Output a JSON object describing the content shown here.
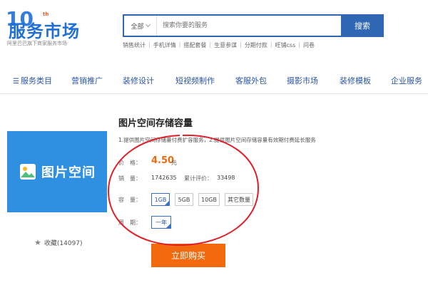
{
  "header": {
    "logo_text": "服务市场",
    "logo_number": "10",
    "logo_suffix": "th",
    "logo_subtitle": "阿里巴巴旗下商家服务市场",
    "search": {
      "category": "全部",
      "placeholder": "搜索你要的服务",
      "button_label": "搜索"
    },
    "hot_links": [
      "销售统计",
      "手机详情",
      "搭配套餐",
      "生意参谋",
      "分期付款",
      "旺铺css",
      "问卷"
    ]
  },
  "nav": {
    "items": [
      "服务类目",
      "营销推广",
      "装修设计",
      "短视频制作",
      "客服外包",
      "摄影市场",
      "装修模板",
      "企业服务"
    ]
  },
  "product": {
    "image_text": "图片空间",
    "title": "图片空间存储容量",
    "description": "1.提供图片空间存储量付费扩容服务，2.提供图片空间存储容量有效期付费延长服务",
    "price_label": "价　格：",
    "price_value": "4.50",
    "price_unit": "元",
    "sales_label": "销　量：",
    "sales_value": "1742635",
    "reviews_label": "累计评价：",
    "reviews_value": "33498",
    "capacity_label": "容　量：",
    "capacity_options": [
      "1GB",
      "5GB",
      "10GB",
      "其它数量"
    ],
    "capacity_selected": "1GB",
    "period_label": "周　期：",
    "period_options": [
      "一年"
    ],
    "period_selected": "一年",
    "buy_label": "立即购买",
    "favorites_label": "收藏(14097)",
    "colors": {
      "brand_blue": "#2f67b5",
      "image_blue": "#2f8fe0",
      "price_orange": "#f0690f",
      "buy_orange": "#f36a0e",
      "annotation_red": "#e0202a"
    }
  }
}
